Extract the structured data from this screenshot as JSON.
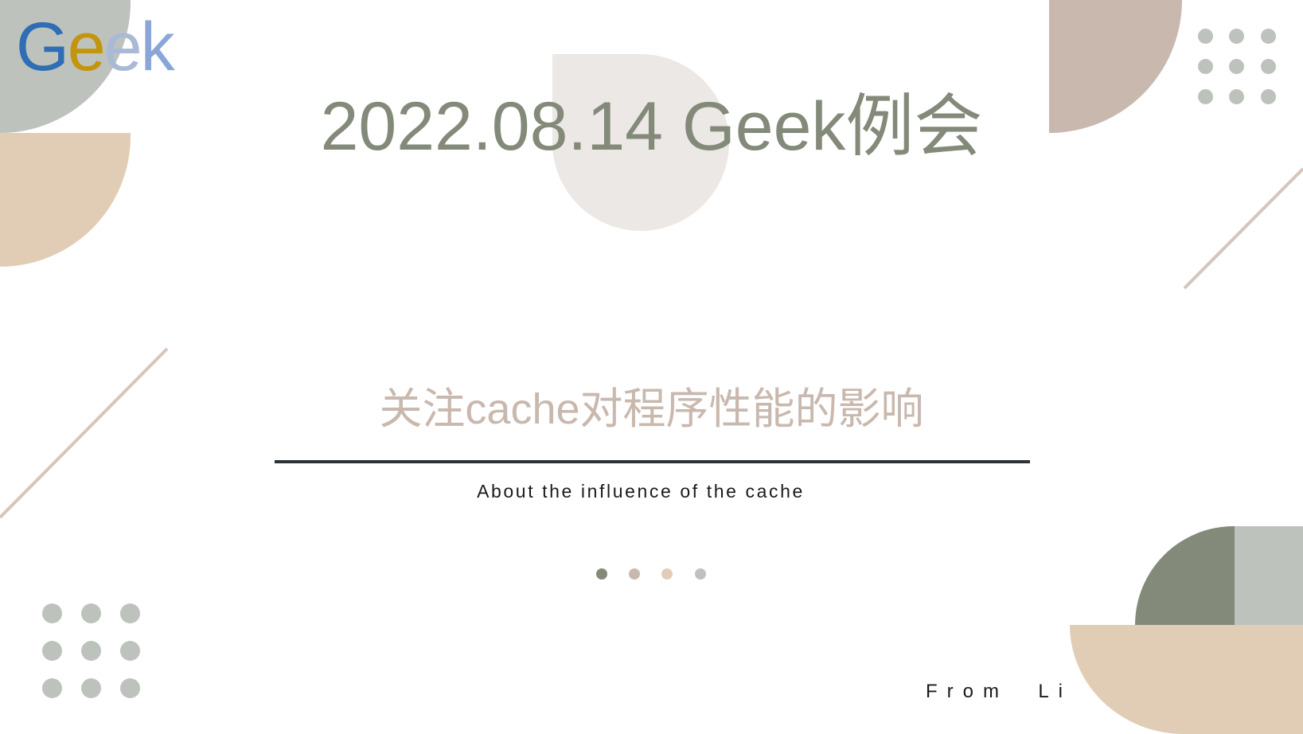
{
  "logo": {
    "letters": [
      "G",
      "e",
      "e",
      "k"
    ],
    "colors": [
      "#2f6db5",
      "#c4940d",
      "#a9b9d6",
      "#8aa6d9"
    ]
  },
  "title": "2022.08.14 Geek例会",
  "subtitle_cn": "关注cache对程序性能的影响",
  "subtitle_en": "About the influence of the cache",
  "author": "From  Li",
  "pager": {
    "count": 4,
    "colors": [
      "#838a79",
      "#c9b8ae",
      "#e1cdb5",
      "#bdc3bc"
    ],
    "active_index": 0
  },
  "palette": {
    "sage": "#838a79",
    "grey": "#bdc3bc",
    "tan": "#e1cdb5",
    "rose": "#c9b8ae",
    "light": "#ebe8e5",
    "rule": "#2c3236"
  }
}
